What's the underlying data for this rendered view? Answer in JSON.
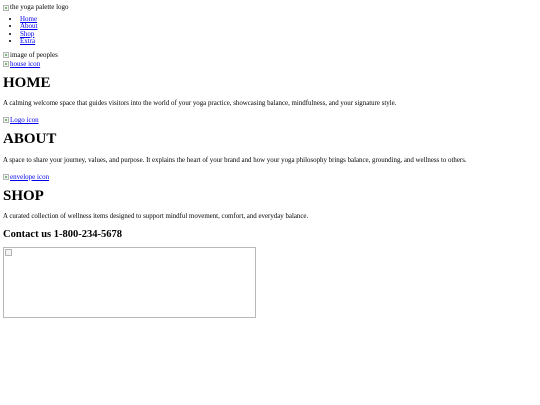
{
  "header": {
    "logo_alt": "the yoga palette logo"
  },
  "nav": {
    "items": [
      {
        "label": "Home"
      },
      {
        "label": "About"
      },
      {
        "label": "Shop"
      },
      {
        "label": "Extra"
      }
    ]
  },
  "hero": {
    "image_alt": "image of peoples"
  },
  "home": {
    "icon_alt": "house icon",
    "title": "HOME",
    "text": "A calming welcome space that guides visitors into the world of your yoga practice, showcasing balance, mindfulness, and your signature style."
  },
  "about": {
    "icon_alt": "Logo icon",
    "title": "ABOUT",
    "text": "A space to share your journey, values, and purpose. It explains the heart of your brand and how your yoga philosophy brings balance, grounding, and wellness to others."
  },
  "shop": {
    "icon_alt": "envelope icon",
    "title": "SHOP",
    "text": "A curated collection of wellness items designed to support mindful movement, comfort, and everyday balance."
  },
  "contact": {
    "title": "Contact us 1-800-234-5678"
  }
}
